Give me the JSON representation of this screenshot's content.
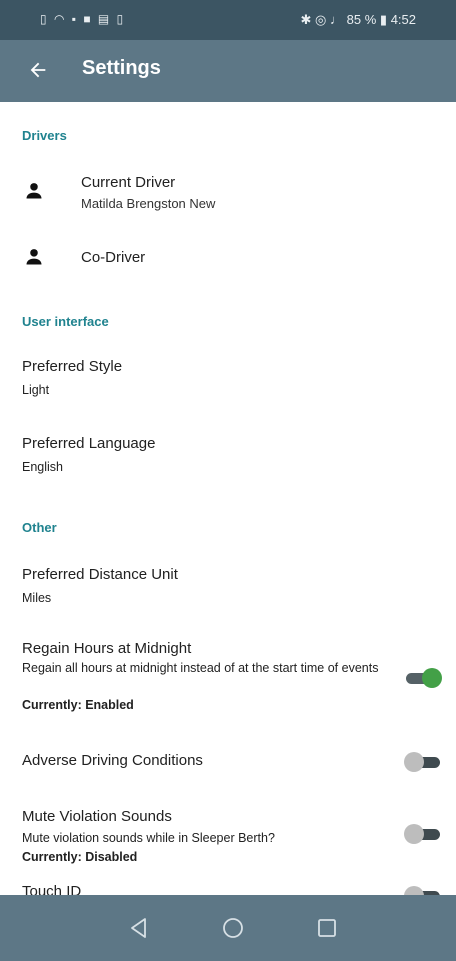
{
  "status_bar": {
    "left_icons": [
      "sim-card-icon",
      "wifi-icon",
      "cast-icon",
      "image-icon",
      "mail-icon",
      "battery-saver-icon"
    ],
    "right_icons": [
      "bluetooth-icon",
      "location-icon",
      "mute-icon"
    ],
    "battery_percent": "85 %",
    "time": "4:52"
  },
  "app_bar": {
    "title": "Settings"
  },
  "sections": {
    "drivers": "Drivers",
    "user_interface": "User interface",
    "other": "Other"
  },
  "drivers": {
    "current": {
      "title": "Current Driver",
      "value": "Matilda Brengston New"
    },
    "co": {
      "title": "Co-Driver"
    }
  },
  "ui": {
    "style": {
      "title": "Preferred Style",
      "value": "Light"
    },
    "language": {
      "title": "Preferred Language",
      "value": "English"
    }
  },
  "other": {
    "distance": {
      "title": "Preferred Distance Unit",
      "value": "Miles"
    },
    "regain": {
      "title": "Regain Hours at Midnight",
      "summary": "Regain all hours at midnight instead of at the start time of events",
      "state": "Currently: Enabled",
      "enabled": true
    },
    "adverse": {
      "title": "Adverse Driving Conditions",
      "enabled": false
    },
    "mute": {
      "title": "Mute Violation Sounds",
      "summary": "Mute violation sounds while in Sleeper Berth?",
      "state": "Currently: Disabled",
      "enabled": false
    },
    "touch_id": {
      "title": "Touch ID",
      "enabled": false
    }
  },
  "colors": {
    "accent": "#20838f",
    "toolbar": "#5d7786",
    "status_bar": "#3c5563",
    "switch_on": "#43a047"
  }
}
